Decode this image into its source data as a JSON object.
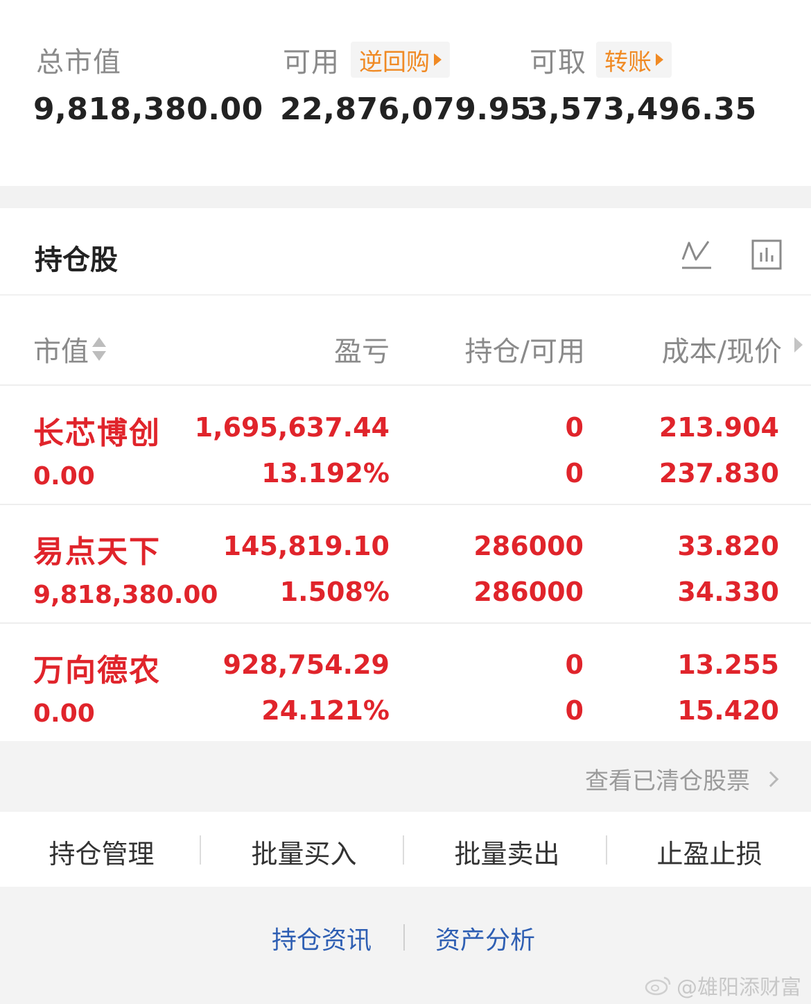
{
  "summary": {
    "total_market_value_label": "总市值",
    "total_market_value": "9,818,380.00",
    "available_label": "可用",
    "available_tag": "逆回购",
    "available_value": "22,876,079.95",
    "withdrawable_label": "可取",
    "withdrawable_tag": "转账",
    "withdrawable_value": "3,573,496.35"
  },
  "holdings": {
    "title": "持仓股",
    "icons": [
      "line-chart-icon",
      "bar-chart-icon"
    ],
    "columns": {
      "market_value": "市值",
      "profit_loss": "盈亏",
      "position": "持仓/可用",
      "cost_price": "成本/现价"
    },
    "rows": [
      {
        "name": "长芯博创",
        "market_value": "0.00",
        "pl_amount": "1,695,637.44",
        "pl_percent": "13.192%",
        "position": "0",
        "available": "0",
        "cost": "213.904",
        "price": "237.830"
      },
      {
        "name": "易点天下",
        "market_value": "9,818,380.00",
        "pl_amount": "145,819.10",
        "pl_percent": "1.508%",
        "position": "286000",
        "available": "286000",
        "cost": "33.820",
        "price": "34.330"
      },
      {
        "name": "万向德农",
        "market_value": "0.00",
        "pl_amount": "928,754.29",
        "pl_percent": "24.121%",
        "position": "0",
        "available": "0",
        "cost": "13.255",
        "price": "15.420"
      }
    ]
  },
  "cleared_link": "查看已清仓股票",
  "actions": [
    "持仓管理",
    "批量买入",
    "批量卖出",
    "止盈止损"
  ],
  "links": [
    "持仓资讯",
    "资产分析"
  ],
  "watermark": "@雄阳添财富",
  "colors": {
    "accent_orange": "#f08a24",
    "loss_profit_red": "#e0242b",
    "link_blue": "#2f5fb3"
  }
}
